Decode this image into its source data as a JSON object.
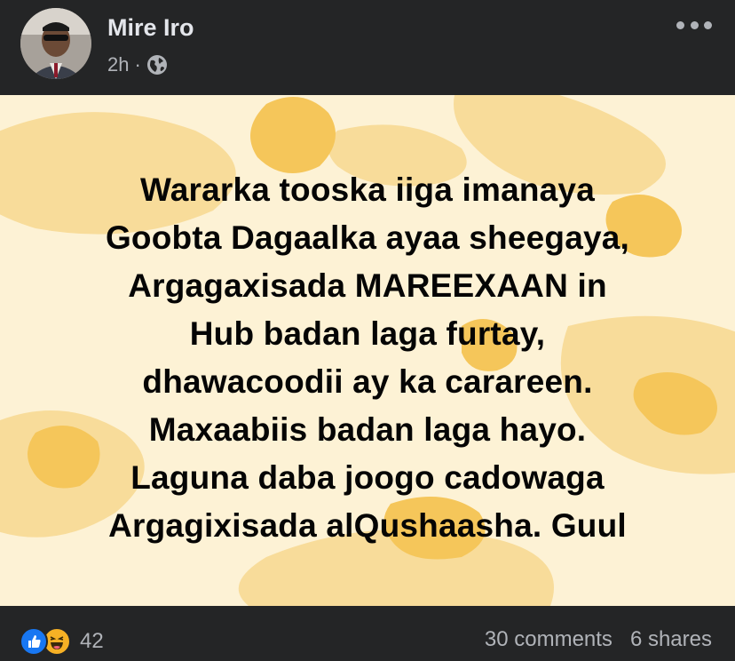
{
  "post": {
    "author": "Mire Iro",
    "time": "2h",
    "separator": "·",
    "lines": [
      "Wararka tooska iiga imanaya",
      "Goobta Dagaalka ayaa sheegaya,",
      "Argagaxisada MAREEXAAN in",
      "Hub badan laga furtay,",
      "dhawacoodii ay ka carareen.",
      "Maxaabiis badan laga hayo.",
      "Laguna daba joogo cadowaga",
      "Argagixisada alQushaasha. Guul"
    ],
    "background_color": "#fdf2d5",
    "blob_color": "#f5c65a"
  },
  "footer": {
    "reaction_count": "42",
    "comments": "30 comments",
    "shares": "6 shares"
  },
  "icons": {
    "privacy": "globe-icon",
    "more": "more-options-icon",
    "reactions": [
      "like-reaction-icon",
      "haha-reaction-icon"
    ]
  }
}
